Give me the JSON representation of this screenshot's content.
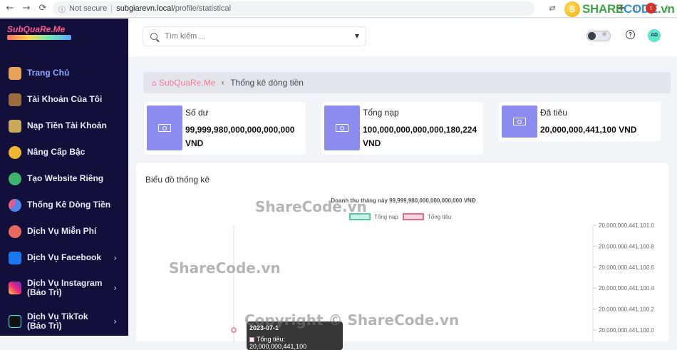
{
  "browser": {
    "back_icon": "arrow-left-icon",
    "forward_icon": "arrow-right-icon",
    "reload_icon": "reload-icon",
    "security": "Not secure",
    "url_host": "subgiarevn.local",
    "url_path": "/profile/statistical",
    "watermark_brand_a": "SHARE",
    "watermark_brand_b": "CODE",
    "watermark_brand_c": ".vn",
    "profile_initial": "t"
  },
  "sidebar": {
    "logo_text": "SubQuaRe.Me",
    "items": [
      {
        "label": "Trang Chủ",
        "icon": "home-icon",
        "color": "#e8a35a"
      },
      {
        "label": "Tài Khoản Của Tôi",
        "icon": "account-icon",
        "color": "#9b6b3c"
      },
      {
        "label": "Nạp Tiền Tài Khoản",
        "icon": "deposit-icon",
        "color": "#c9a95b"
      },
      {
        "label": "Nâng Cấp Bậc",
        "icon": "crown-icon",
        "color": "#f2b530"
      },
      {
        "label": "Tạo Website Riêng",
        "icon": "globe-icon",
        "color": "#3db36b"
      },
      {
        "label": "Thống Kê Dòng Tiền",
        "icon": "pie-chart-icon",
        "color": "#4f86e8"
      },
      {
        "label": "Dịch Vụ Miễn Phí",
        "icon": "gift-icon",
        "color": "#e86a5f"
      },
      {
        "label": "Dịch Vụ Facebook",
        "icon": "facebook-icon",
        "color": "#1877f2"
      },
      {
        "label": "Dịch Vụ Instagram (Bảo Trì)",
        "icon": "instagram-icon",
        "color": "#d6306b"
      },
      {
        "label": "Dịch Vụ TikTok (Bảo Trì)",
        "icon": "tiktok-icon",
        "color": "#111111"
      }
    ]
  },
  "topbar": {
    "search_placeholder": "Tìm kiếm ...",
    "user_initials": "AD"
  },
  "breadcrumb": {
    "root": "SubQuaRe.Me",
    "current": "Thống kê dòng tiền"
  },
  "cards": [
    {
      "title": "Số dư",
      "value": "99,999,980,000,000,000,000 VND"
    },
    {
      "title": "Tổng nạp",
      "value": "100,000,000,000,000,180,224 VND"
    },
    {
      "title": "Đã tiêu",
      "value": "20,000,000,441,100 VND"
    }
  ],
  "chart_section": {
    "heading": "Biểu đồ thống kê",
    "tooltip_date": "2023-07-1",
    "tooltip_value": "Tổng tiêu: 20,000,000,441,100"
  },
  "chart_data": {
    "type": "line",
    "title": "Doanh thu tháng này 99,999,980,000,000,000,000 VNĐ",
    "series": [
      {
        "name": "Tổng nạp",
        "color": "#4fc9a8",
        "values": []
      },
      {
        "name": "Tổng tiêu",
        "color": "#e36b87",
        "values": [
          20000000441100
        ]
      }
    ],
    "y_right_ticks": [
      "20,000,000,441,101.0",
      "20,000,000,441,100.8",
      "20,000,000,441,100.6",
      "20,000,000,441,100.4",
      "20,000,000,441,100.2",
      "20,000,000,441,100.0"
    ],
    "legend_position": "top-center"
  },
  "watermarks": [
    "ShareCode.vn",
    "ShareCode.vn",
    "Copyright © ShareCode.vn"
  ]
}
